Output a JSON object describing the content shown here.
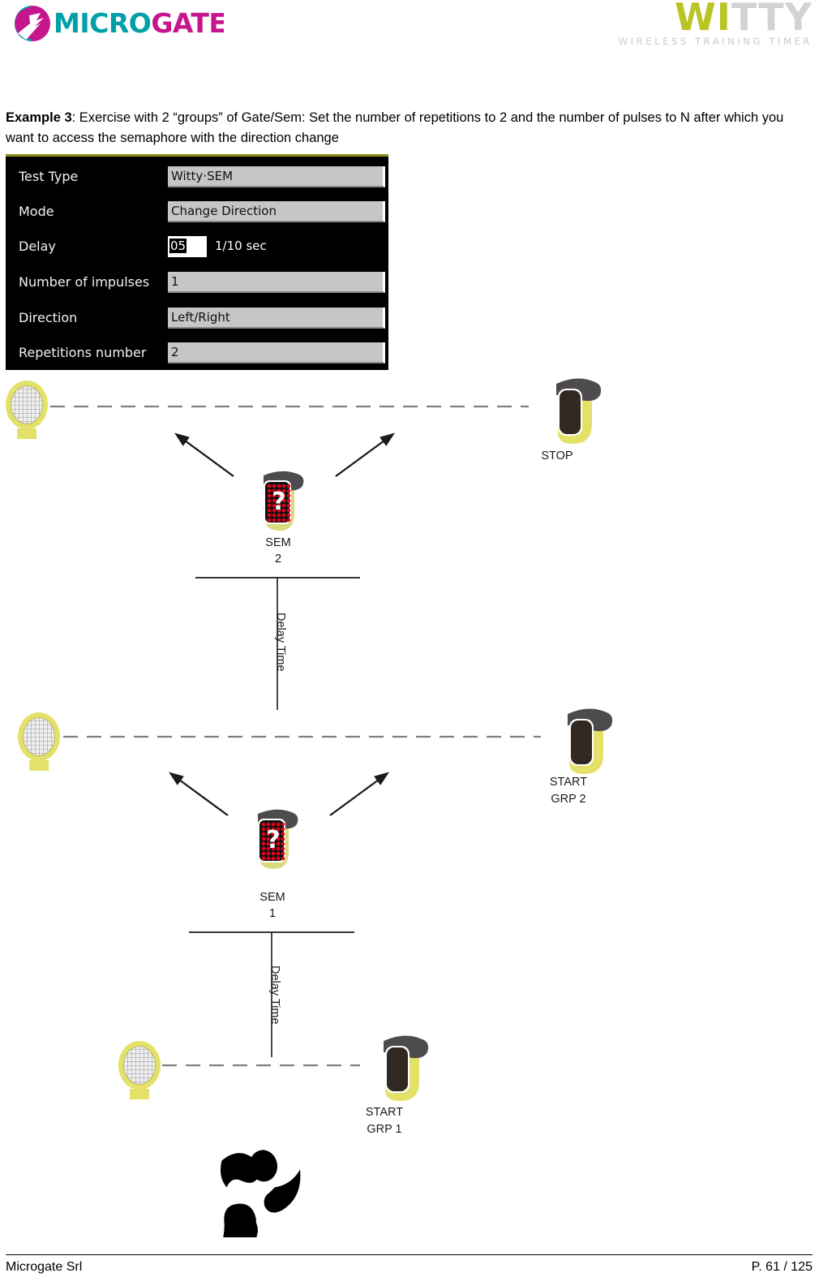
{
  "header": {
    "brand_logo": "microgate-logo",
    "brand_name": "MICROGATE",
    "product_word_1": "WI",
    "product_word_2": "TTY",
    "product_tagline": "WIRELESS  TRAINING  TIMER",
    "colors": {
      "microgate_teal": "#00a0a8",
      "microgate_magenta": "#c6168d",
      "witty_olive": "#b9c425",
      "witty_gray": "#d2d3d3"
    }
  },
  "intro": {
    "label_bold": "Example 3",
    "text": ": Exercise with 2 “groups” of Gate/Sem: Set the number of repetitions to 2 and the number of pulses to N after which you want to access the semaphore with the direction change"
  },
  "settings_panel": {
    "rows": [
      {
        "label": "Test Type",
        "value": "Witty·SEM",
        "type": "dropdown"
      },
      {
        "label": "Mode",
        "value": "Change Direction",
        "type": "dropdown"
      },
      {
        "label": "Delay",
        "value": "05",
        "type": "spinner",
        "suffix": "1/10 sec"
      },
      {
        "label": "Number of impulses",
        "value": "1",
        "type": "dropdown"
      },
      {
        "label": "Direction",
        "value": "Left/Right",
        "type": "dropdown"
      },
      {
        "label": "Repetitions number",
        "value": "2",
        "type": "dropdown"
      }
    ]
  },
  "diagram": {
    "groups": [
      {
        "gate_label_line1": "STOP",
        "gate_label_line2": "",
        "semaphore_label_line1": "SEM",
        "semaphore_label_line2": "2",
        "semaphore_glyph": "?",
        "delay_label": "Delay Time"
      },
      {
        "gate_label_line1": "START",
        "gate_label_line2": "GRP 2",
        "semaphore_label_line1": "SEM",
        "semaphore_label_line2": "1",
        "semaphore_glyph": "?",
        "delay_label": "Delay Time"
      },
      {
        "gate_label_line1": "START",
        "gate_label_line2": "GRP 1",
        "semaphore_label_line1": "",
        "semaphore_label_line2": "",
        "semaphore_glyph": "",
        "delay_label": ""
      }
    ],
    "athlete_icon": "runner-icon",
    "colors": {
      "device_yellow": "#e3e167",
      "device_dark": "#4d4b4d",
      "device_lens": "#312822",
      "reflector_ring": "#e3e167",
      "led_red": "#e2001a",
      "beam_line": "#808080"
    }
  },
  "footer": {
    "company": "Microgate Srl",
    "page": "P. 61 / 125"
  }
}
